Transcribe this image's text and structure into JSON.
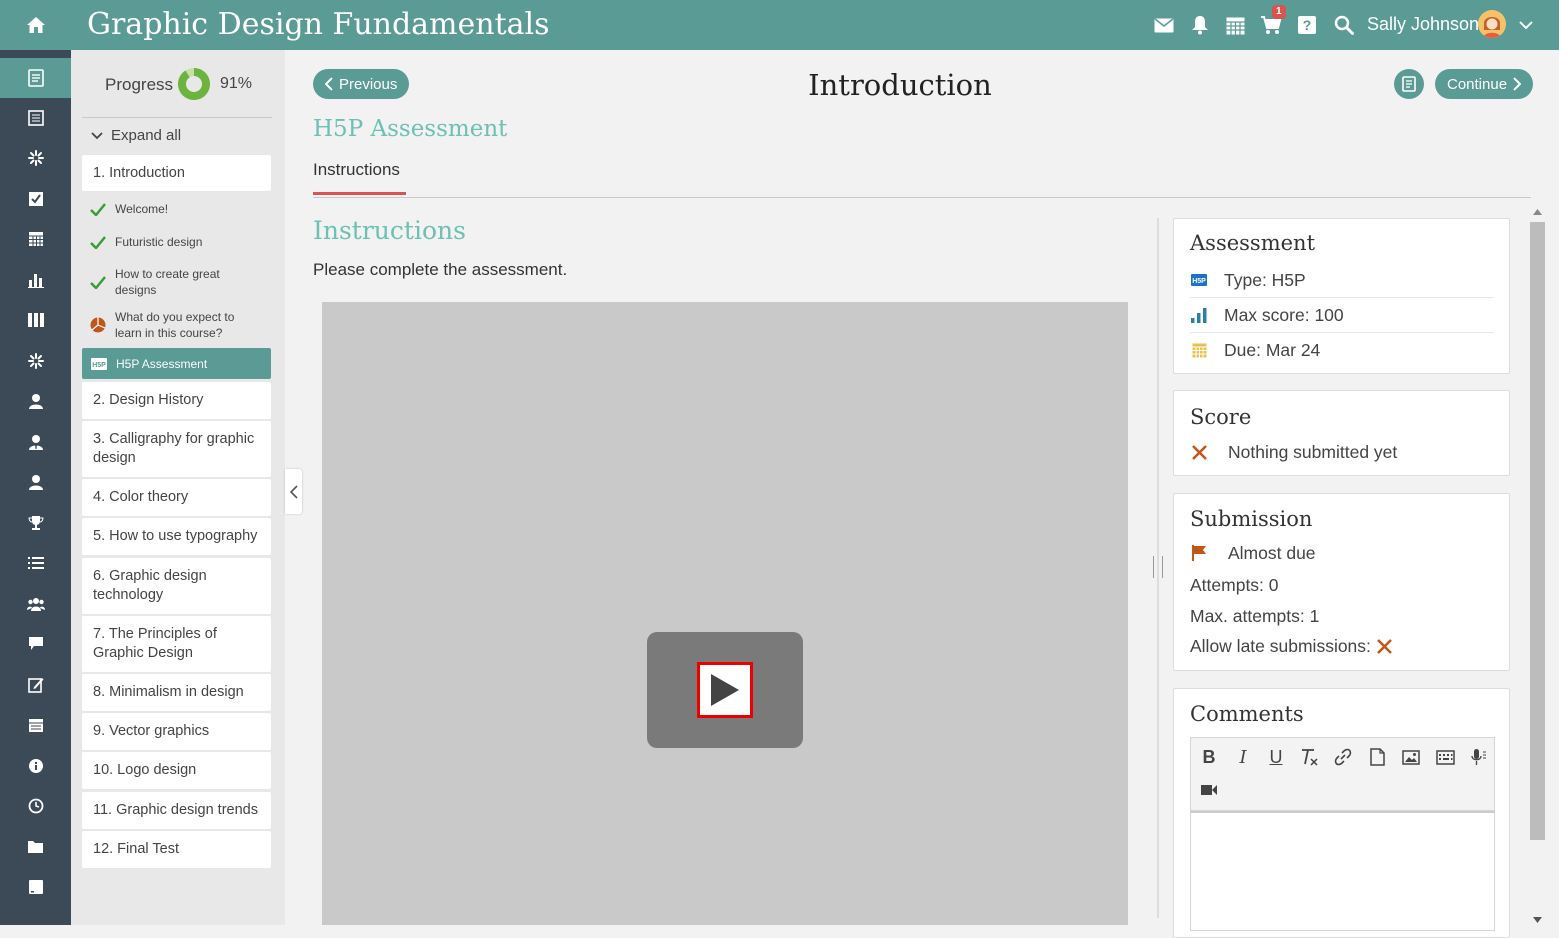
{
  "header": {
    "title": "Graphic Design Fundamentals",
    "cart_count": "1",
    "user_name": "Sally Johnson",
    "icons": [
      "home-icon",
      "mail-icon",
      "bell-icon",
      "calendar-icon",
      "cart-icon",
      "help-icon",
      "search-icon",
      "chevron-down-icon"
    ]
  },
  "sidebar": {
    "icons": [
      "courses-icon",
      "catalog-icon",
      "groups-icon",
      "assignments-icon",
      "calendar-icon",
      "reports-icon",
      "library-icon",
      "branches-icon",
      "user-icon",
      "teacher-icon",
      "parent-icon",
      "trophy-icon",
      "list-icon",
      "team-icon",
      "chat-icon",
      "edit-icon",
      "schedule-icon",
      "info-icon",
      "clock-icon",
      "folder-icon",
      "tablet-icon"
    ]
  },
  "outline": {
    "progress_label": "Progress",
    "progress_value": "91%",
    "progress_fraction": 0.91,
    "expand_all": "Expand all",
    "chapters": [
      "1. Introduction",
      "2. Design History",
      "3. Calligraphy for graphic design",
      "4. Color theory",
      "5. How to use typography",
      "6. Graphic design technology",
      "7. The Principles of Graphic Design",
      "8. Minimalism in design",
      "9. Vector graphics",
      "10. Logo design",
      "11. Graphic design trends",
      "12. Final Test"
    ],
    "lessons": [
      {
        "label": "Welcome!",
        "status": "completed"
      },
      {
        "label": "Futuristic design",
        "status": "completed"
      },
      {
        "label": "How to create great designs",
        "status": "completed"
      },
      {
        "label": "What do you expect to learn in this course?",
        "status": "survey"
      },
      {
        "label": "H5P Assessment",
        "status": "current"
      }
    ]
  },
  "content": {
    "previous_label": "Previous",
    "page_title": "Introduction",
    "continue_label": "Continue",
    "section_title": "H5P Assessment",
    "tab_label": "Instructions",
    "instructions_heading": "Instructions",
    "instructions_text": "Please complete the assessment."
  },
  "assessment": {
    "heading": "Assessment",
    "type": "Type: H5P",
    "type_icon": "H5P",
    "max_score": "Max score: 100",
    "due": "Due: Mar 24"
  },
  "score": {
    "heading": "Score",
    "status": "Nothing submitted yet"
  },
  "submission": {
    "heading": "Submission",
    "status": "Almost due",
    "attempts": "Attempts: 0",
    "max_attempts": "Max. attempts: 1",
    "late": "Allow late submissions:"
  },
  "comments": {
    "heading": "Comments",
    "toolbar": [
      "B",
      "I",
      "U"
    ]
  },
  "colors": {
    "brand": "#5a9b95",
    "accent_teal": "#6cc0b4",
    "sidebar_bg": "#3c4a57",
    "tab_underline": "#d9534f",
    "cross": "#c0561a"
  }
}
